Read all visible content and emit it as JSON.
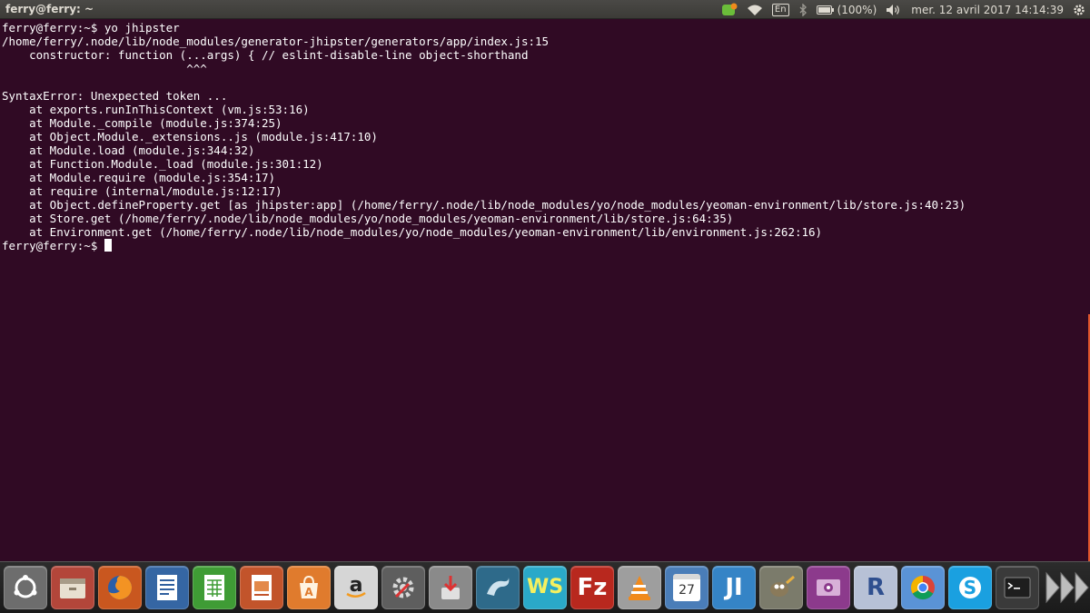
{
  "window": {
    "title": "ferry@ferry: ~"
  },
  "top_panel": {
    "keyboard_layout": "En",
    "battery_text": "(100%)",
    "clock": "mer. 12 avril 2017 14:14:39",
    "icons": [
      "update-notifier-icon",
      "wifi-icon",
      "keyboard-layout-indicator",
      "bluetooth-icon",
      "battery-icon",
      "volume-icon"
    ]
  },
  "terminal": {
    "lines": [
      "ferry@ferry:~$ yo jhipster",
      "/home/ferry/.node/lib/node_modules/generator-jhipster/generators/app/index.js:15",
      "    constructor: function (...args) { // eslint-disable-line object-shorthand",
      "                           ^^^",
      "",
      "SyntaxError: Unexpected token ...",
      "    at exports.runInThisContext (vm.js:53:16)",
      "    at Module._compile (module.js:374:25)",
      "    at Object.Module._extensions..js (module.js:417:10)",
      "    at Module.load (module.js:344:32)",
      "    at Function.Module._load (module.js:301:12)",
      "    at Module.require (module.js:354:17)",
      "    at require (internal/module.js:12:17)",
      "    at Object.defineProperty.get [as jhipster:app] (/home/ferry/.node/lib/node_modules/yo/node_modules/yeoman-environment/lib/store.js:40:23)",
      "    at Store.get (/home/ferry/.node/lib/node_modules/yo/node_modules/yeoman-environment/lib/store.js:64:35)",
      "    at Environment.get (/home/ferry/.node/lib/node_modules/yo/node_modules/yeoman-environment/lib/environment.js:262:16)"
    ],
    "prompt": "ferry@ferry:~$ ",
    "colors": {
      "background": "#300a24",
      "foreground": "#ffffff"
    }
  },
  "launcher": {
    "calendar_day": "27",
    "items": [
      {
        "name": "ubuntu-dash-icon",
        "color": "#7d7d7d"
      },
      {
        "name": "files-icon",
        "color": "#c94a3a"
      },
      {
        "name": "firefox-icon",
        "color": "#d45d20"
      },
      {
        "name": "libreoffice-writer-icon",
        "color": "#2f5f9e"
      },
      {
        "name": "libreoffice-calc-icon",
        "color": "#3f9c35"
      },
      {
        "name": "libreoffice-impress-icon",
        "color": "#c2542b"
      },
      {
        "name": "software-center-icon",
        "color": "#e07b2d"
      },
      {
        "name": "amazon-icon",
        "color": "#c9c9c9"
      },
      {
        "name": "system-settings-icon",
        "color": "#6e6e6e"
      },
      {
        "name": "archive-installer-icon",
        "color": "#8a8a8a"
      },
      {
        "name": "mysql-workbench-icon",
        "color": "#2e6a8a"
      },
      {
        "name": "webstorm-icon",
        "color": "#2aa9c9"
      },
      {
        "name": "filezilla-icon",
        "color": "#b8281e"
      },
      {
        "name": "vlc-icon",
        "color": "#a7a7a7"
      },
      {
        "name": "calendar-icon",
        "color": "#4a7db8"
      },
      {
        "name": "jetbrains-idea-icon",
        "color": "#3584c6"
      },
      {
        "name": "gimp-icon",
        "color": "#7b7b6b"
      },
      {
        "name": "video-recorder-icon",
        "color": "#8c3a8c"
      },
      {
        "name": "rstudio-icon",
        "color": "#9aa6c0"
      },
      {
        "name": "chrome-icon",
        "color": "#4a8bd6"
      },
      {
        "name": "skype-icon",
        "color": "#1aa0e0"
      },
      {
        "name": "terminal-icon",
        "color": "#3a3a3a"
      }
    ]
  }
}
